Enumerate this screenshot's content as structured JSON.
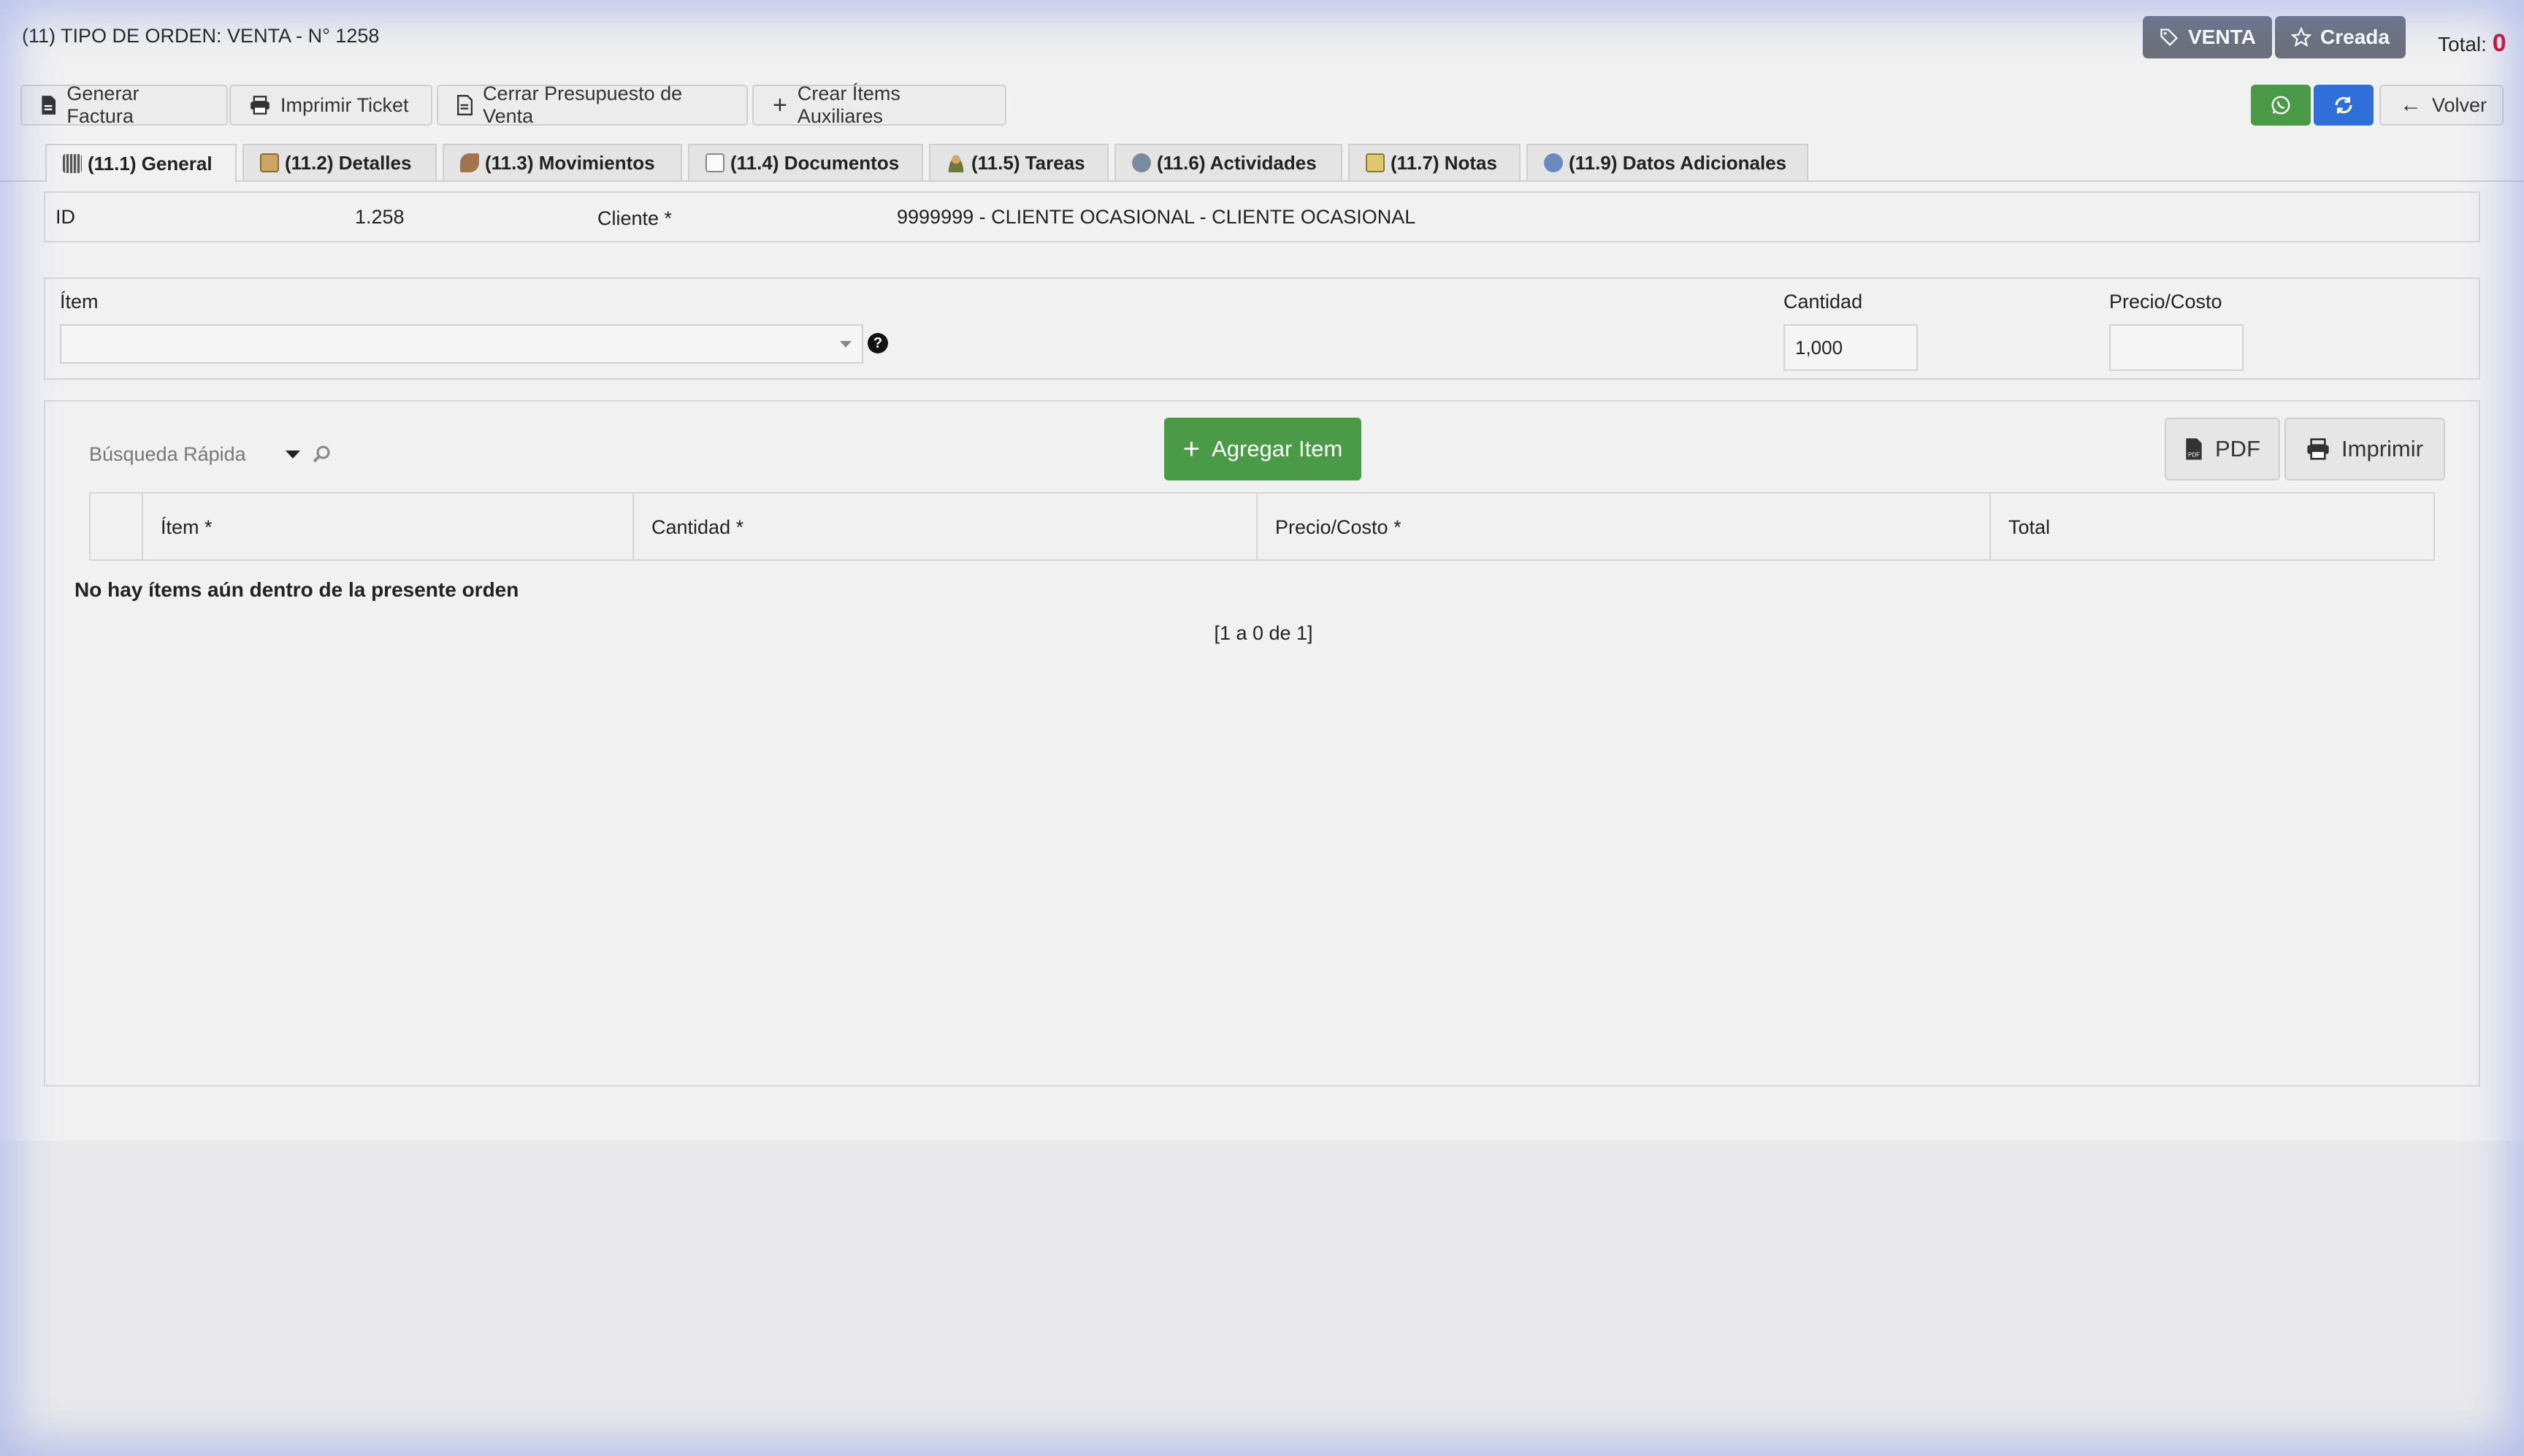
{
  "header": {
    "title": "(11) TIPO DE ORDEN: VENTA - N° 1258",
    "badge_type": "VENTA",
    "badge_status": "Creada",
    "total_label": "Total:",
    "total_value": "0"
  },
  "toolbar": {
    "generar_factura": "Generar Factura",
    "imprimir_ticket": "Imprimir Ticket",
    "cerrar_presupuesto": "Cerrar Presupuesto de Venta",
    "crear_items_aux": "Crear Ítems Auxiliares",
    "volver": "Volver"
  },
  "tabs": [
    {
      "label": "(11.1) General",
      "icon": "barcode-icon"
    },
    {
      "label": "(11.2) Detalles",
      "icon": "clipboard-icon"
    },
    {
      "label": "(11.3) Movimientos",
      "icon": "movement-icon"
    },
    {
      "label": "(11.4) Documentos",
      "icon": "document-icon"
    },
    {
      "label": "(11.5) Tareas",
      "icon": "user-icon"
    },
    {
      "label": "(11.6) Actividades",
      "icon": "activity-icon"
    },
    {
      "label": "(11.7) Notas",
      "icon": "notes-icon"
    },
    {
      "label": "(11.9) Datos Adicionales",
      "icon": "info-icon"
    }
  ],
  "general": {
    "id_label": "ID",
    "id_value": "1.258",
    "cliente_label": "Cliente *",
    "cliente_value": "9999999 - CLIENTE OCASIONAL - CLIENTE OCASIONAL"
  },
  "item_form": {
    "item_label": "Ítem",
    "item_value": "",
    "cantidad_label": "Cantidad",
    "cantidad_value": "1,000",
    "precio_label": "Precio/Costo",
    "precio_value": ""
  },
  "items_panel": {
    "search_placeholder": "Búsqueda Rápida",
    "add_button": "Agregar Item",
    "pdf_button": "PDF",
    "print_button": "Imprimir",
    "columns": [
      "Ítem *",
      "Cantidad *",
      "Precio/Costo *",
      "Total"
    ],
    "empty_message": "No hay ítems aún dentro de la presente orden",
    "pagination": "[1 a 0 de 1]"
  },
  "colors": {
    "green": "#4b9a47",
    "blue": "#2e6fd9",
    "badge": "#6b717a",
    "total_red": "#d0021b"
  }
}
